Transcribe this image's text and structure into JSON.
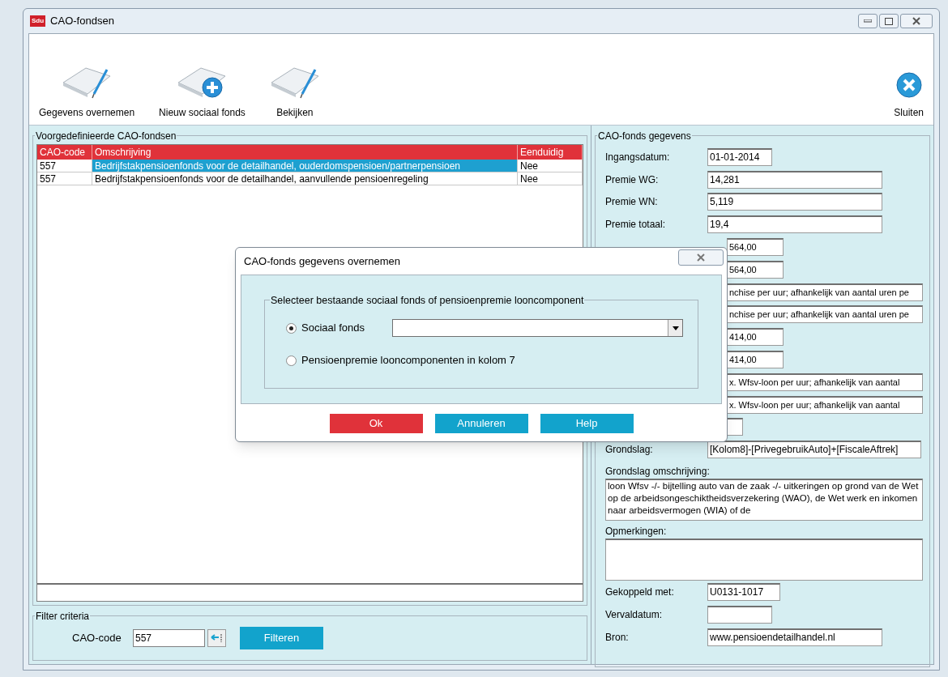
{
  "window": {
    "title": "CAO-fondsen",
    "app_icon": "Sdu"
  },
  "toolbar": [
    {
      "kind": "sheet",
      "label": "Gegevens overnemen"
    },
    {
      "kind": "add",
      "label": "Nieuw sociaal fonds"
    },
    {
      "kind": "sheet",
      "label": "Bekijken"
    },
    {
      "kind": "close",
      "label": "Sluiten"
    }
  ],
  "list_panel": {
    "title": "Voorgedefinieerde CAO-fondsen",
    "columns": [
      "CAO-code",
      "Omschrijving",
      "Eenduidig"
    ],
    "rows": [
      {
        "cells": [
          "557",
          "Bedrijfstakpensioenfonds voor de detailhandel, ouderdomspensioen/partnerpensioen",
          "Nee"
        ],
        "selected": true
      },
      {
        "cells": [
          "557",
          "Bedrijfstakpensioenfonds voor de detailhandel, aanvullende pensioenregeling",
          "Nee"
        ],
        "selected": false
      }
    ]
  },
  "filter": {
    "title": "Filter criteria",
    "label": "CAO-code",
    "value": "557",
    "button": "Filteren"
  },
  "details": {
    "title": "CAO-fonds gegevens",
    "fields": [
      {
        "label": "Ingangsdatum:",
        "value": "01-01-2014",
        "kind": "short"
      },
      {
        "label": "Premie WG:",
        "value": "14,281",
        "kind": "long"
      },
      {
        "label": "Premie WN:",
        "value": "5,119",
        "kind": "long"
      },
      {
        "label": "Premie totaal:",
        "value": "19,4",
        "kind": "long"
      },
      {
        "value": "564,00",
        "kind": "medium"
      },
      {
        "value": "564,00",
        "kind": "medium"
      },
      {
        "value": "nchise per uur; afhankelijk van aantal uren pe",
        "kind": "wide"
      },
      {
        "value": "nchise per uur; afhankelijk van aantal uren pe",
        "kind": "wide"
      },
      {
        "value": "414,00",
        "kind": "medium"
      },
      {
        "value": "414,00",
        "kind": "medium"
      },
      {
        "value": "x. Wfsv-loon per uur; afhankelijk van aantal",
        "kind": "wide"
      },
      {
        "value": "x. Wfsv-loon per uur; afhankelijk van aantal",
        "kind": "wide"
      },
      {
        "kind": "tiny"
      },
      {
        "label": "Grondslag:",
        "value": "[Kolom8]-[PrivegebruikAuto]+[FiscaleAftrek]",
        "kind": "wide"
      },
      {
        "label": "Grondslag omschrijving:",
        "value": "loon Wfsv -/- bijtelling auto van de zaak -/- uitkeringen op grond van de Wet op de arbeidsongeschiktheidsverzekering (WAO), de Wet werk en inkomen naar arbeidsvermogen (WIA) of de",
        "kind": "area"
      },
      {
        "label": "Opmerkingen:",
        "kind": "area"
      },
      {
        "label": "Gekoppeld met:",
        "value": "U0131-1017",
        "kind": "medium"
      },
      {
        "label": "Vervaldatum:",
        "kind": "short"
      },
      {
        "label": "Bron:",
        "value": "www.pensioendetailhandel.nl",
        "kind": "long"
      }
    ]
  },
  "dialog": {
    "title": "CAO-fonds gegevens overnemen",
    "group_title": "Selecteer bestaande sociaal fonds of pensioenpremie looncomponent",
    "options": [
      {
        "label": "Sociaal fonds",
        "selected": true,
        "kind": "dropdown"
      },
      {
        "label": "Pensioenpremie looncomponenten in kolom 7",
        "selected": false,
        "kind": "plain"
      }
    ],
    "buttons": [
      {
        "label": "Ok",
        "kind": "primary"
      },
      {
        "label": "Annuleren",
        "kind": "secondary"
      },
      {
        "label": "Help",
        "kind": "secondary"
      }
    ]
  }
}
